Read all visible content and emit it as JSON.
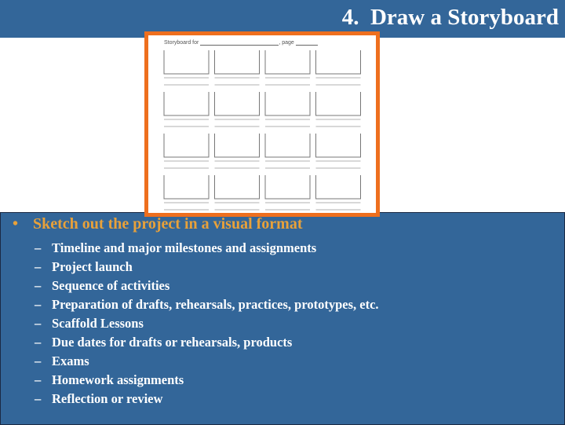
{
  "slide": {
    "title": "4.  Draw a Storyboard",
    "storyboard": {
      "header_label": "Storyboard for",
      "page_label": ", page",
      "rows": 4,
      "cols": 4
    },
    "bullet": {
      "marker": "•",
      "text": "Sketch out the project in a visual format"
    },
    "sub_marker": "–",
    "sub_items": [
      "Timeline and major milestones and assignments",
      "Project launch",
      "Sequence of activities",
      "Preparation of drafts, rehearsals, practices, prototypes, etc.",
      "Scaffold Lessons",
      "Due dates for drafts or rehearsals, products",
      "Exams",
      "Homework assignments",
      "Reflection or review"
    ],
    "colors": {
      "background_blue": "#336699",
      "accent_orange": "#ee6f1e",
      "bullet_gold": "#e8a13a",
      "text_white": "#ffffff"
    }
  }
}
